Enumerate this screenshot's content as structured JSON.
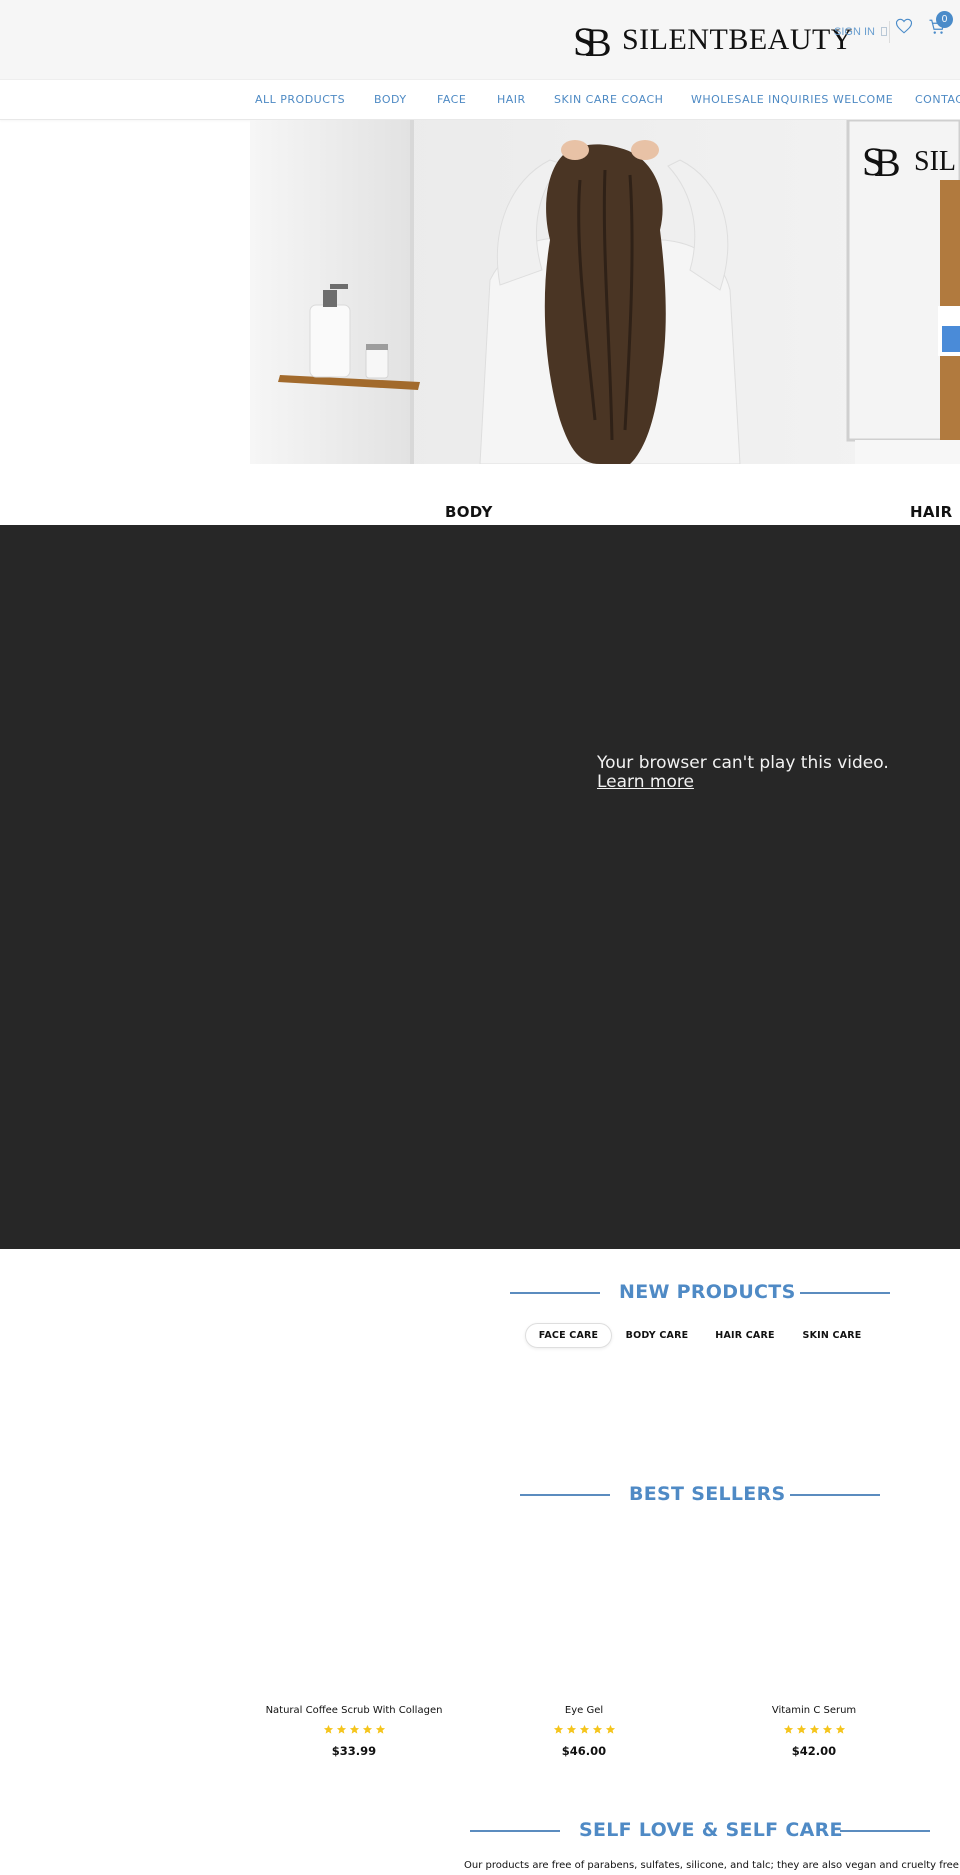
{
  "header": {
    "brand": "SILENTBEAUTY",
    "sign_in": "SIGN IN",
    "cart_count": "0",
    "icons": [
      "logo-monogram-icon",
      "user-icon",
      "heart-icon",
      "cart-icon"
    ]
  },
  "nav": {
    "items": [
      {
        "label": "ALL PRODUCTS"
      },
      {
        "label": "BODY"
      },
      {
        "label": "FACE"
      },
      {
        "label": "HAIR"
      },
      {
        "label": "SKIN CARE COACH"
      },
      {
        "label": "WHOLESALE INQUIRIES WELCOME"
      },
      {
        "label": "CONTAC"
      }
    ]
  },
  "categories": {
    "body": "BODY",
    "hair": "HAIR"
  },
  "video": {
    "message": "Your browser can't play this video.",
    "link": "Learn more"
  },
  "new_products": {
    "title": "NEW PRODUCTS",
    "tabs": [
      {
        "label": "FACE CARE",
        "active": true
      },
      {
        "label": "BODY CARE",
        "active": false
      },
      {
        "label": "HAIR CARE",
        "active": false
      },
      {
        "label": "SKIN CARE",
        "active": false
      }
    ]
  },
  "best_sellers": {
    "title": "BEST SELLERS",
    "products": [
      {
        "name": "Natural Coffee Scrub With Collagen",
        "rating": 5,
        "price": "$33.99"
      },
      {
        "name": "Eye Gel",
        "rating": 5,
        "price": "$46.00"
      },
      {
        "name": "Vitamin C Serum",
        "rating": 5,
        "price": "$42.00"
      }
    ]
  },
  "self_love": {
    "title": "SELF LOVE & SELF CARE",
    "intro": "Our products are free of parabens, sulfates, silicone, and talc; they are also vegan and cruelty free."
  },
  "colors": {
    "accent": "#4f8ac5",
    "nav_text": "#4e8ac4",
    "topbar_bg": "#f6f6f6",
    "video_bg": "#272727",
    "star": "#f5c51d"
  }
}
